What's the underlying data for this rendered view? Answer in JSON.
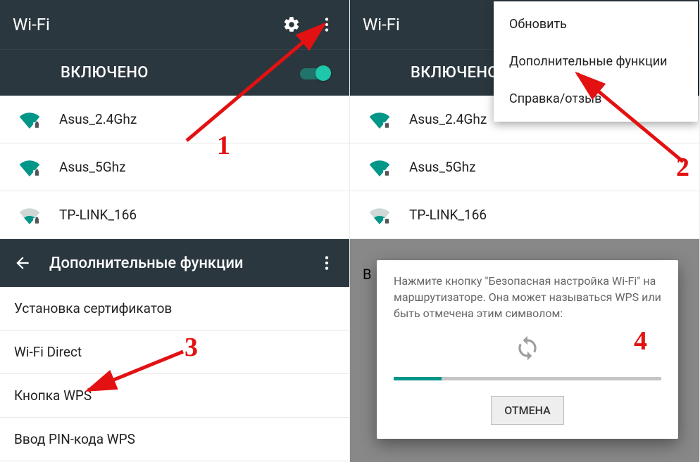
{
  "annotations": {
    "n1": "1",
    "n2": "2",
    "n3": "3",
    "n4": "4"
  },
  "panel1": {
    "title": "Wi-Fi",
    "enabled_label": "ВКЛЮЧЕНО",
    "networks": [
      {
        "name": "Asus_2.4Ghz",
        "strength": "full",
        "locked": true
      },
      {
        "name": "Asus_5Ghz",
        "strength": "full",
        "locked": true
      },
      {
        "name": "TP-LINK_166",
        "strength": "weak",
        "locked": true
      }
    ]
  },
  "panel2": {
    "title": "Wi-Fi",
    "enabled_label": "ВКЛЮЧЕНО",
    "menu": {
      "refresh": "Обновить",
      "advanced": "Дополнительные функции",
      "help": "Справка/отзыв"
    },
    "networks": [
      {
        "name": "Asus_2.4Ghz",
        "strength": "full",
        "locked": true
      },
      {
        "name": "Asus_5Ghz",
        "strength": "full",
        "locked": true
      },
      {
        "name": "TP-LINK_166",
        "strength": "weak",
        "locked": true
      }
    ]
  },
  "panel3": {
    "title": "Дополнительные функции",
    "options": {
      "install_certs": "Установка сертификатов",
      "wifi_direct": "Wi-Fi Direct",
      "wps_button": "Кнопка WPS",
      "wps_pin": "Ввод PIN-кода WPS"
    }
  },
  "panel4": {
    "bg_letter": "В",
    "dialog_msg": "Нажмите кнопку \"Безопасная настройка Wi-Fi\" на маршрутизаторе. Она может называться WPS или быть отмечена этим символом:",
    "cancel": "ОТМЕНА"
  }
}
